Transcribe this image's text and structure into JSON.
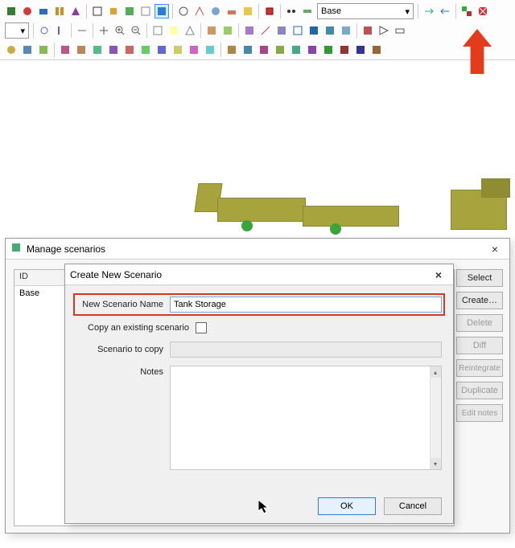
{
  "toolbar": {
    "combo_small": "",
    "combo_scenario": "Base"
  },
  "arrow_hint": "↓",
  "manage_dialog": {
    "title": "Manage scenarios",
    "close": "×",
    "list": {
      "header": "ID",
      "rows": [
        "Base"
      ]
    },
    "buttons": {
      "select": "Select",
      "create": "Create…",
      "delete": "Delete",
      "diff": "Diff",
      "reintegrate": "Reintegrate",
      "duplicate": "Duplicate",
      "edit_notes": "Edit notes"
    }
  },
  "create_dialog": {
    "title": "Create New Scenario",
    "close": "×",
    "labels": {
      "name": "New Scenario Name",
      "copy": "Copy an existing scenario",
      "scenario_to_copy": "Scenario to copy",
      "notes": "Notes"
    },
    "values": {
      "name": "Tank Storage"
    },
    "buttons": {
      "ok": "OK",
      "cancel": "Cancel"
    }
  }
}
